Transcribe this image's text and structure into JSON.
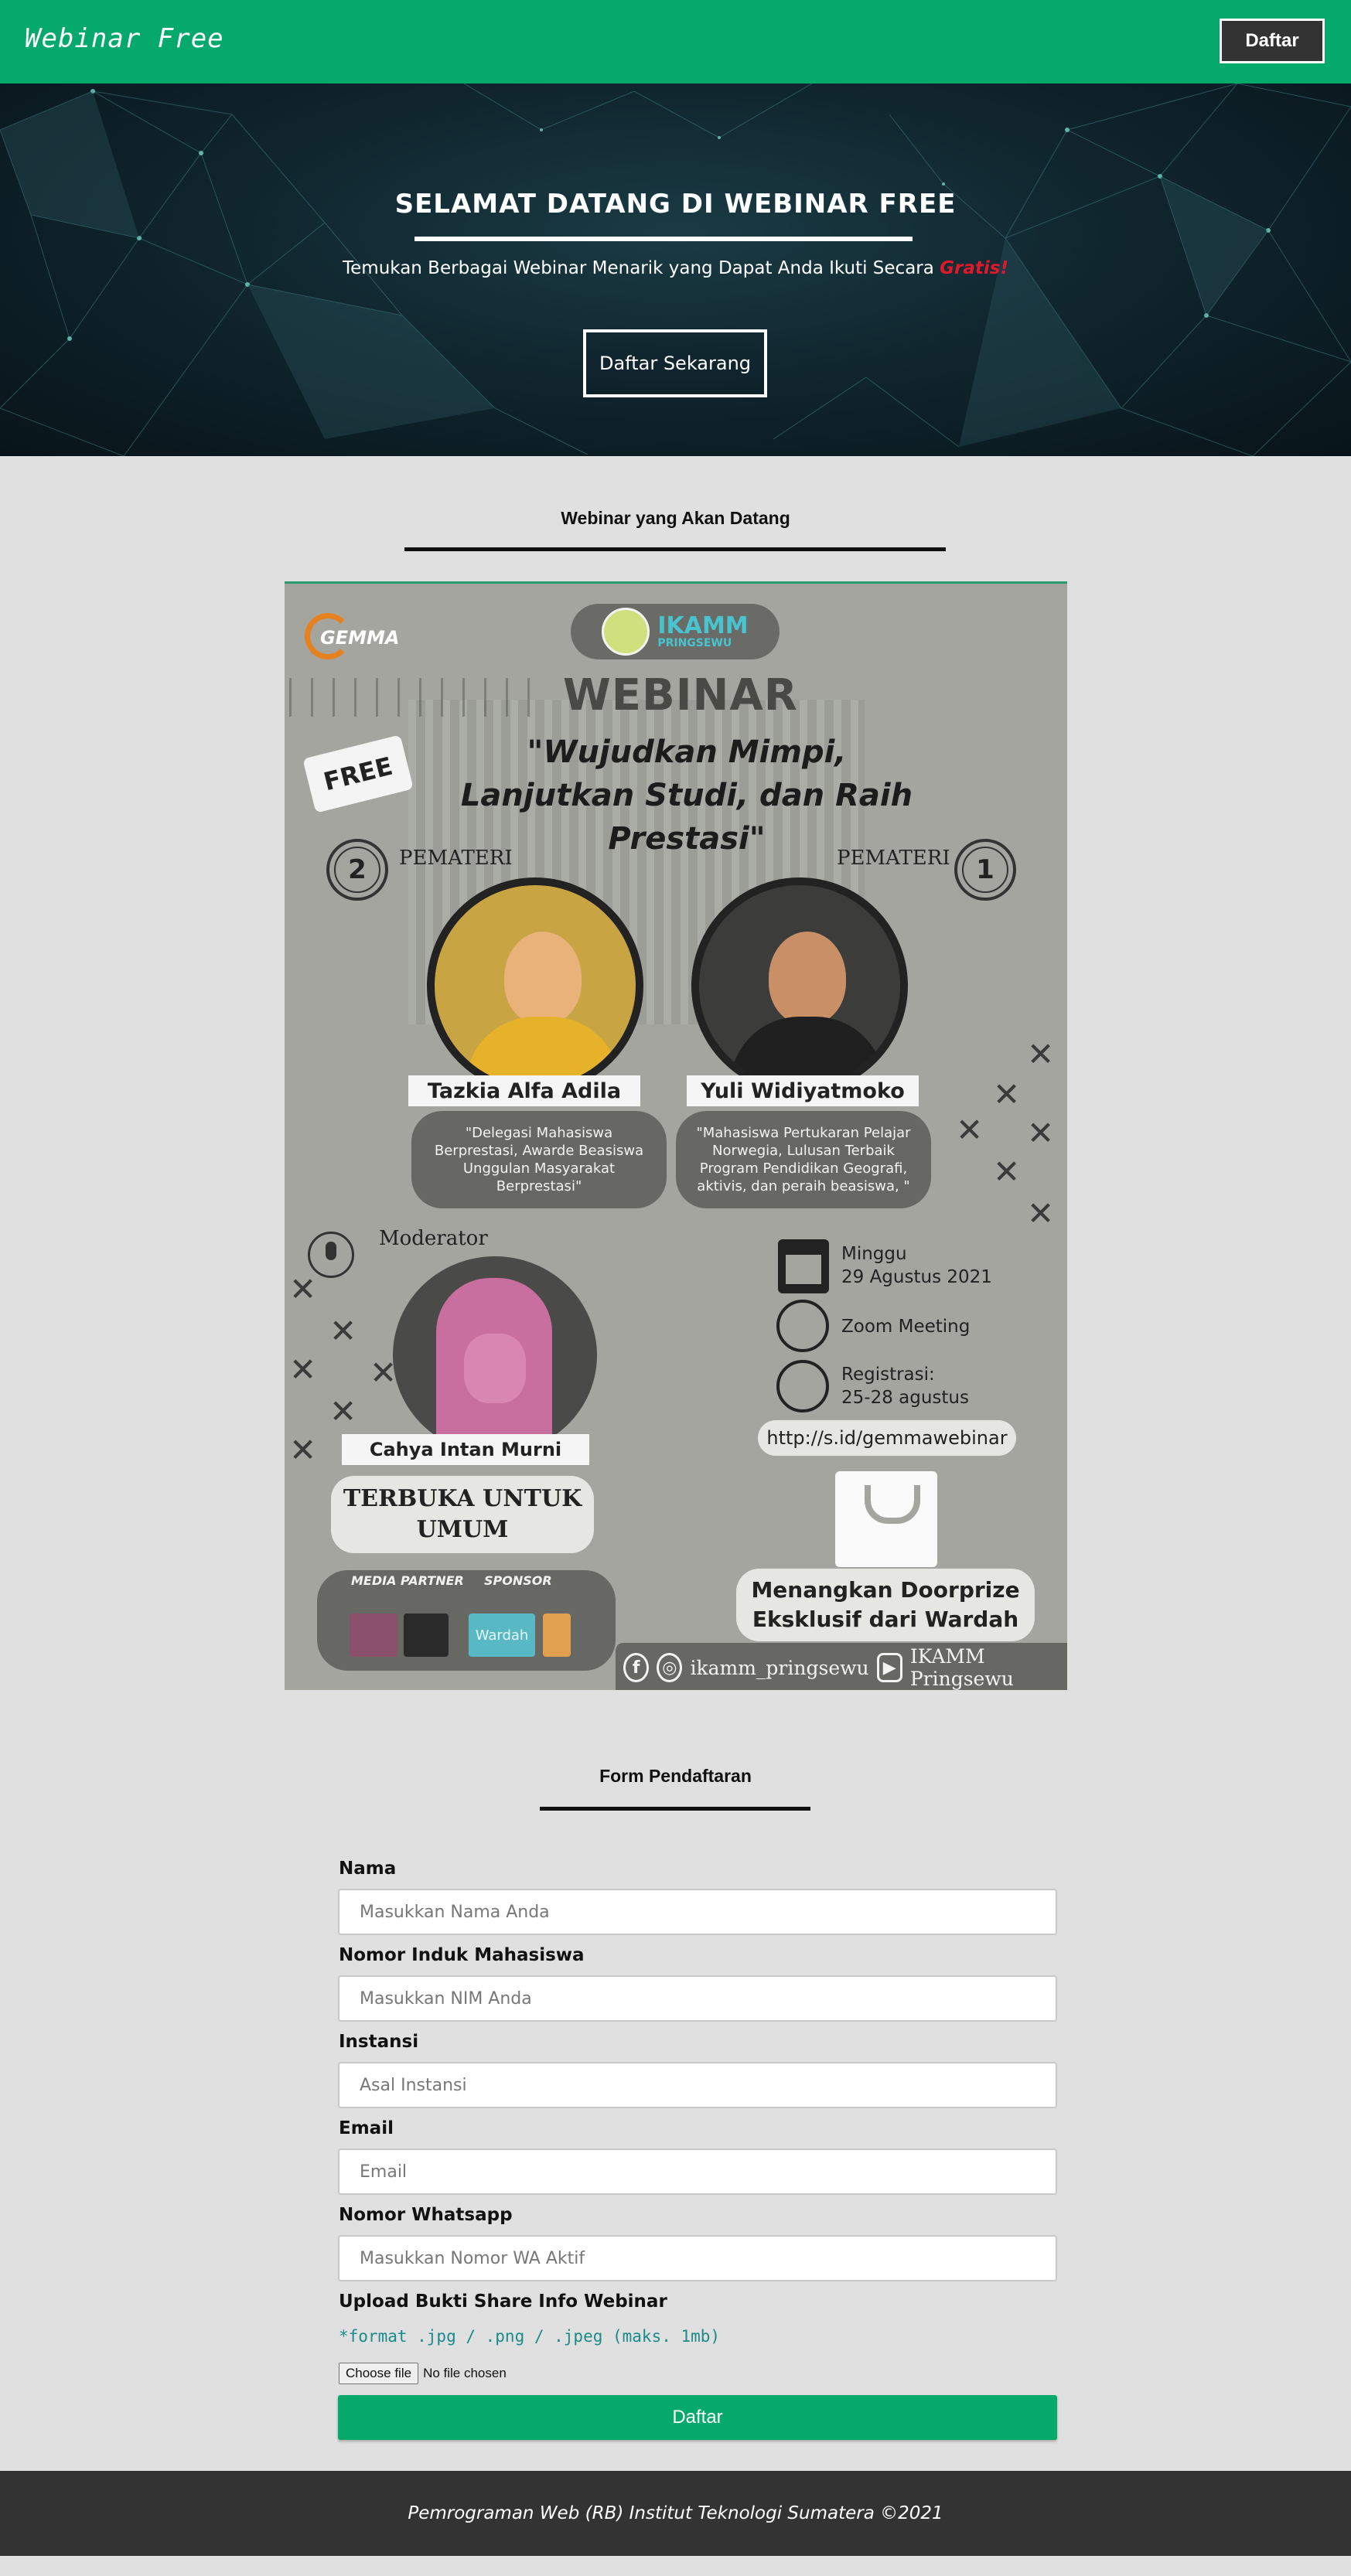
{
  "navbar": {
    "brand": "Webinar Free",
    "register_button": "Daftar",
    "background_color": "#05a96b"
  },
  "hero": {
    "title": "SELAMAT DATANG DI WEBINAR FREE",
    "subtitle": "Temukan Berbagai Webinar Menarik yang Dapat Anda Ikuti Secara",
    "subtitle_emphasis": "Gratis!",
    "cta_button": "Daftar Sekarang"
  },
  "upcoming": {
    "heading": "Webinar yang Akan Datang",
    "poster": {
      "org_badge": "IKAMM",
      "org_badge_sub": "PRINGSEWU",
      "org_logo": "GEMMA",
      "label": "WEBINAR",
      "free_tag": "FREE",
      "theme": "\"Wujudkan Mimpi, Lanjutkan Studi, dan Raih Prestasi\"",
      "speakers": [
        {
          "number": "2",
          "label": "PEMATERI",
          "name": "Tazkia Alfa Adila",
          "description": "\"Delegasi Mahasiswa Berprestasi, Awarde Beasiswa Unggulan Masyarakat  Berprestasi\""
        },
        {
          "number": "1",
          "label": "PEMATERI",
          "name": "Yuli Widiyatmoko",
          "description": "\"Mahasiswa Pertukaran Pelajar Norwegia, Lulusan Terbaik Program Pendidikan Geografi, aktivis, dan peraih beasiswa, \""
        }
      ],
      "moderator_label": "Moderator",
      "moderator_name": "Cahya Intan Murni",
      "day": "Minggu",
      "date": "29 Agustus 2021",
      "platform": "Zoom Meeting",
      "registration_label": "Registrasi:",
      "registration_dates": "25-28 agustus",
      "link": "http://s.id/gemmawebinar",
      "open_to": "TERBUKA UNTUK UMUM",
      "media_partner_label": "MEDIA PARTNER",
      "sponsor_label": "SPONSOR",
      "sponsor_logo": "Wardah",
      "doorprize": "Menangkan Doorprize Eksklusif dari Wardah",
      "instagram": "ikamm_pringsewu",
      "youtube": "IKAMM Pringsewu"
    }
  },
  "form": {
    "heading": "Form Pendaftaran",
    "fields": [
      {
        "label": "Nama",
        "placeholder": "Masukkan Nama Anda",
        "value": ""
      },
      {
        "label": "Nomor Induk Mahasiswa",
        "placeholder": "Masukkan NIM Anda",
        "value": ""
      },
      {
        "label": "Instansi",
        "placeholder": "Asal Instansi",
        "value": ""
      },
      {
        "label": "Email",
        "placeholder": "Email",
        "value": ""
      },
      {
        "label": "Nomor Whatsapp",
        "placeholder": "Masukkan Nomor WA Aktif",
        "value": ""
      }
    ],
    "upload": {
      "label": "Upload Bukti Share Info Webinar",
      "hint": "*format .jpg / .png / .jpeg (maks. 1mb)",
      "choose_button": "Choose file",
      "file_status": "No file chosen"
    },
    "submit_button": "Daftar"
  },
  "footer": {
    "text": "Pemrograman Web (RB) Institut Teknologi Sumatera ©2021"
  }
}
